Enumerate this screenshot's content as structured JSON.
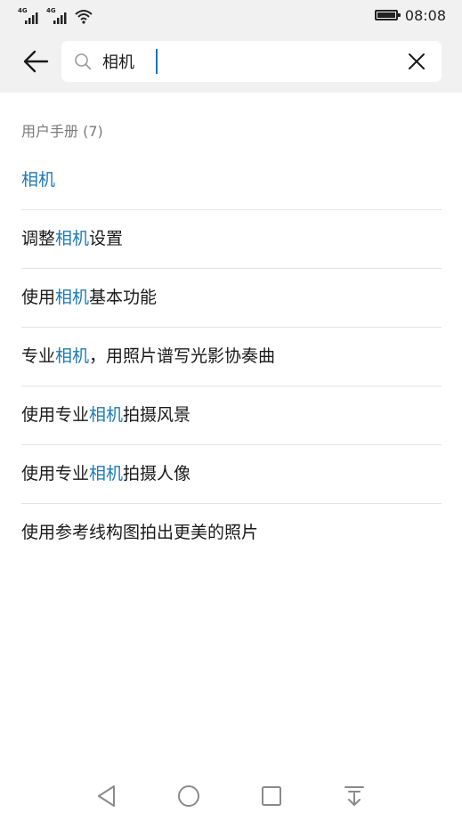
{
  "status_bar": {
    "network_1": "4G",
    "network_2": "4G",
    "time": "08:08",
    "battery_level": 1.0
  },
  "search": {
    "query": "相机",
    "placeholder": ""
  },
  "section": {
    "title": "用户手册 (7)"
  },
  "results": [
    {
      "pre": "",
      "hl": "相机",
      "post": ""
    },
    {
      "pre": "调整",
      "hl": "相机",
      "post": "设置"
    },
    {
      "pre": "使用",
      "hl": "相机",
      "post": "基本功能"
    },
    {
      "pre": "专业",
      "hl": "相机",
      "post": "，用照片谱写光影协奏曲"
    },
    {
      "pre": "使用专业",
      "hl": "相机",
      "post": "拍摄风景"
    },
    {
      "pre": "使用专业",
      "hl": "相机",
      "post": "拍摄人像"
    },
    {
      "pre": "使用参考线构图拍出更美的照片",
      "hl": "",
      "post": ""
    }
  ],
  "colors": {
    "highlight": "#1d7ab8",
    "header_bg": "#f1f1f1",
    "caret": "#1a73b5"
  },
  "icons": {
    "back": "arrow-left-icon",
    "search": "search-icon",
    "clear": "close-icon",
    "nav_back": "triangle-back-icon",
    "nav_home": "circle-home-icon",
    "nav_recent": "square-recent-icon",
    "nav_notification": "pull-down-notification-icon"
  }
}
